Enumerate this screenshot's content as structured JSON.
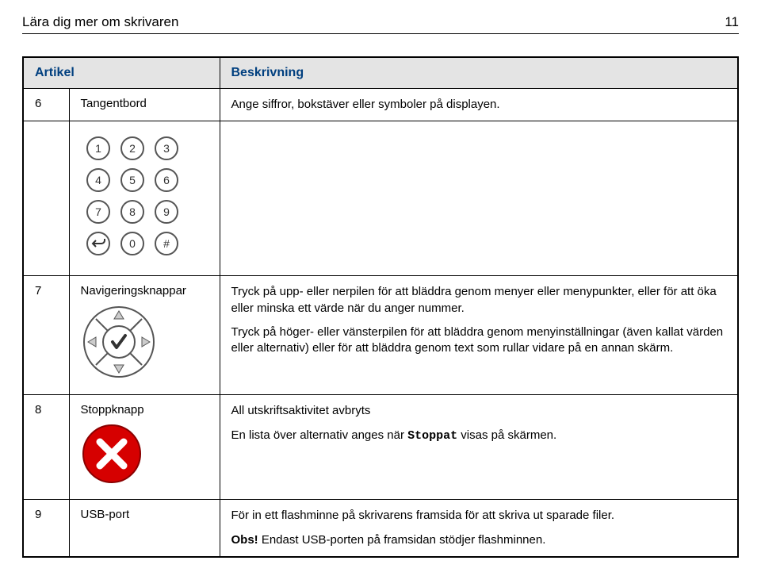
{
  "header": {
    "title": "Lära dig mer om skrivaren",
    "page": "11"
  },
  "table": {
    "head": {
      "col1": "Artikel",
      "col2": "Beskrivning"
    },
    "row6": {
      "num": "6",
      "label": "Tangentbord",
      "desc": "Ange siffror, bokstäver eller symboler på displayen.",
      "keypad": {
        "keys": [
          "1",
          "2",
          "3",
          "4",
          "5",
          "6",
          "7",
          "8",
          "9",
          "",
          "0",
          "#"
        ],
        "backIcon": "back-arrow-icon"
      }
    },
    "row7": {
      "num": "7",
      "label": "Navigeringsknappar",
      "p1": "Tryck på upp- eller nerpilen för att bläddra genom menyer eller menypunkter, eller för att öka eller minska ett värde när du anger nummer.",
      "p2": "Tryck på höger- eller vänsterpilen för att bläddra genom menyinställningar (även kallat värden eller alternativ) eller för att bläddra genom text som rullar vidare på en annan skärm."
    },
    "row8": {
      "num": "8",
      "label": "Stoppknapp",
      "p1": "All utskriftsaktivitet avbryts",
      "p2a": "En lista över alternativ anges när ",
      "p2mono": "Stoppat",
      "p2b": " visas på skärmen."
    },
    "row9": {
      "num": "9",
      "label": "USB-port",
      "p1": "För in ett flashminne på skrivarens framsida för att skriva ut sparade filer.",
      "p2a": "Obs!",
      "p2b": " Endast USB-porten på framsidan stödjer flashminnen."
    }
  }
}
